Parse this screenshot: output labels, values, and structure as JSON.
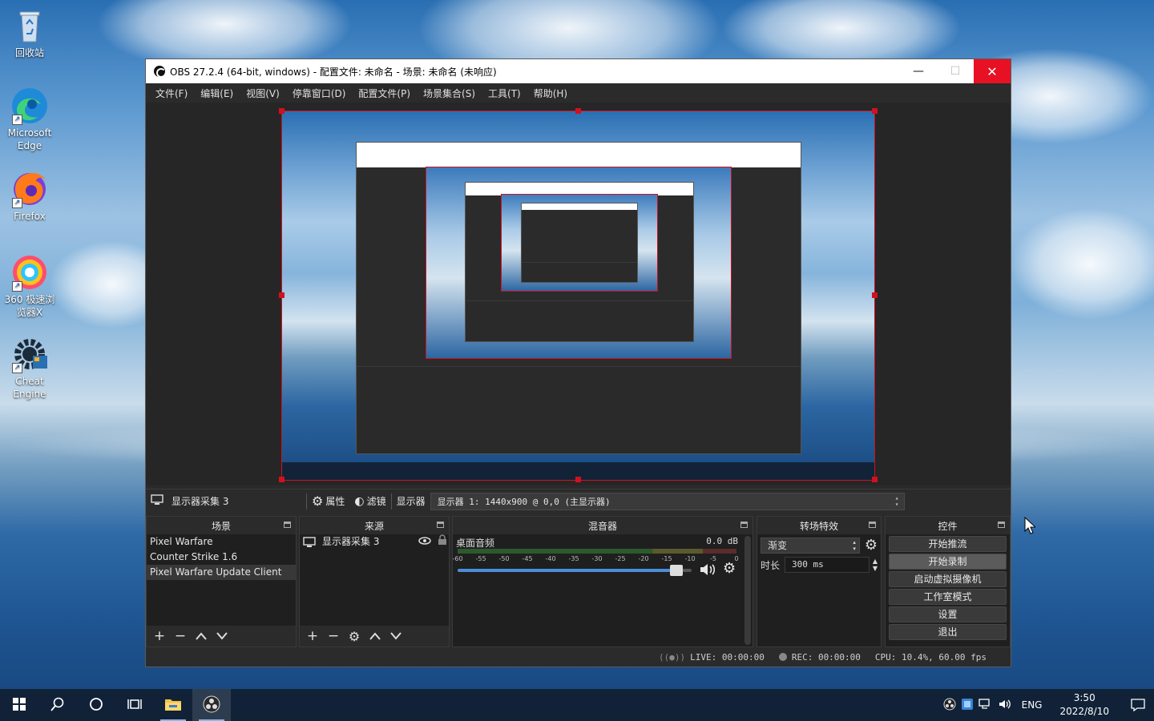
{
  "desktop": {
    "icons": [
      {
        "label": "回收站",
        "icon": "recycle-bin-icon"
      },
      {
        "label": "Microsoft Edge",
        "icon": "edge-icon"
      },
      {
        "label": "Firefox",
        "icon": "firefox-icon"
      },
      {
        "label": "360 极速浏览器X",
        "icon": "browser-360-icon"
      },
      {
        "label": "Cheat Engine",
        "icon": "cheat-engine-icon"
      }
    ]
  },
  "window": {
    "title": "OBS 27.2.4 (64-bit, windows) - 配置文件: 未命名 - 场景: 未命名 (未响应)",
    "minimize": "—",
    "maximize": "☐",
    "close": "✕"
  },
  "menu": [
    "文件(F)",
    "编辑(E)",
    "视图(V)",
    "停靠窗口(D)",
    "配置文件(P)",
    "场景集合(S)",
    "工具(T)",
    "帮助(H)"
  ],
  "source_toolbar": {
    "selected_source": "显示器采集 3",
    "properties": "属性",
    "filters": "滤镜",
    "display_label": "显示器",
    "display_value": "显示器 1: 1440x900 @ 0,0 (主显示器)"
  },
  "docks": {
    "scenes": {
      "title": "场景",
      "items": [
        "Pixel Warfare",
        "Counter Strike 1.6",
        "Pixel Warfare Update Client"
      ],
      "selected": 2
    },
    "sources": {
      "title": "来源",
      "items": [
        "显示器采集 3"
      ]
    },
    "mixer": {
      "title": "混音器",
      "track": "桌面音频",
      "level": "0.0 dB",
      "ticks": [
        "-60",
        "-55",
        "-50",
        "-45",
        "-40",
        "-35",
        "-30",
        "-25",
        "-20",
        "-15",
        "-10",
        "-5",
        "0"
      ],
      "volume": 0.95
    },
    "transitions": {
      "title": "转场特效",
      "type": "渐变",
      "duration_label": "时长",
      "duration": "300 ms"
    },
    "controls": {
      "title": "控件",
      "buttons": [
        "开始推流",
        "开始录制",
        "启动虚拟摄像机",
        "工作室模式",
        "设置",
        "退出"
      ],
      "highlighted": 1
    }
  },
  "status": {
    "live": "LIVE: 00:00:00",
    "rec": "REC: 00:00:00",
    "cpu": "CPU: 10.4%, 60.00 fps"
  },
  "taskbar": {
    "tray_lang": "ENG",
    "time": "3:50",
    "date": "2022/8/10"
  },
  "colors": {
    "accent": "#d0111f",
    "close_btn": "#e81123",
    "panel": "#2b2b2b",
    "dock_bg": "#1f1f1f"
  }
}
